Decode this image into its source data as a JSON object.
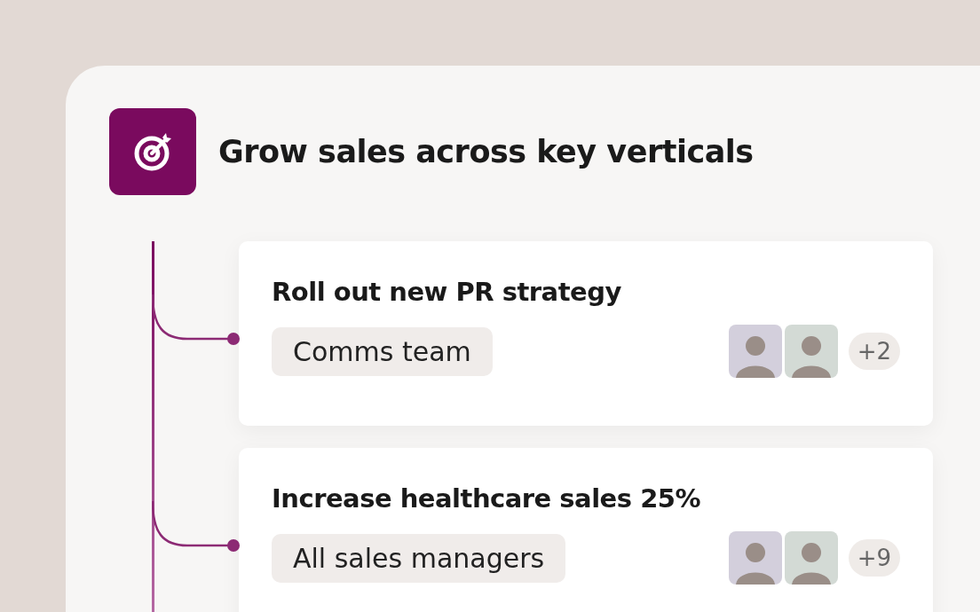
{
  "goal": {
    "title": "Grow sales across key verticals"
  },
  "initiatives": [
    {
      "title": "Roll out new PR strategy",
      "team": "Comms team",
      "more_members": "+2"
    },
    {
      "title": "Increase healthcare sales 25%",
      "team": "All sales managers",
      "more_members": "+9"
    }
  ]
}
